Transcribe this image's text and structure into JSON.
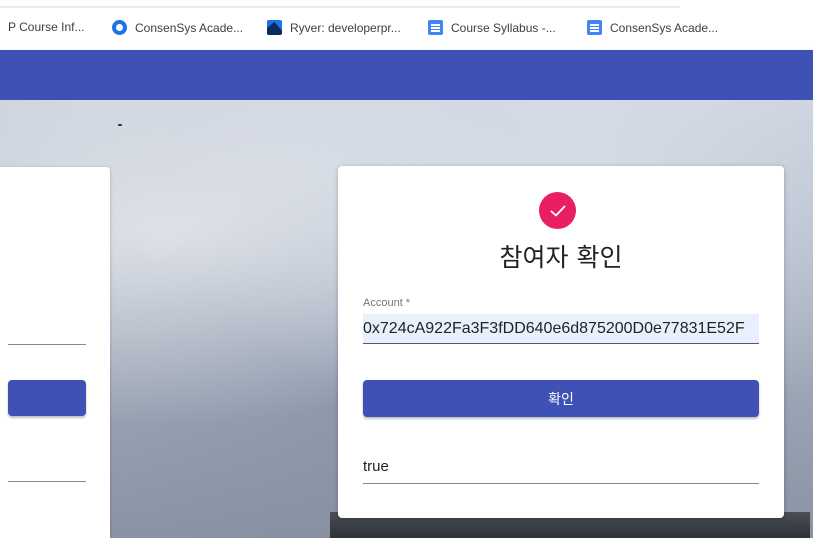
{
  "bookmarks": [
    {
      "label": "P Course Inf...",
      "icon": "none"
    },
    {
      "label": "ConsenSys Acade...",
      "icon": "consensys-icon"
    },
    {
      "label": "Ryver: developerpr...",
      "icon": "ryver-icon"
    },
    {
      "label": "Course Syllabus -...",
      "icon": "doc-icon"
    },
    {
      "label": "ConsenSys Acade...",
      "icon": "doc-icon"
    }
  ],
  "colors": {
    "appbar": "#3f51b5",
    "accent": "#e91e63",
    "button": "#3f51b5"
  },
  "card": {
    "title": "참여자 확인",
    "account_label": "Account *",
    "account_value": "0x724cA922Fa3F3fDD640e6d875200D0e77831E52F",
    "confirm_label": "확인",
    "result": "true",
    "status_icon": "check-icon"
  }
}
